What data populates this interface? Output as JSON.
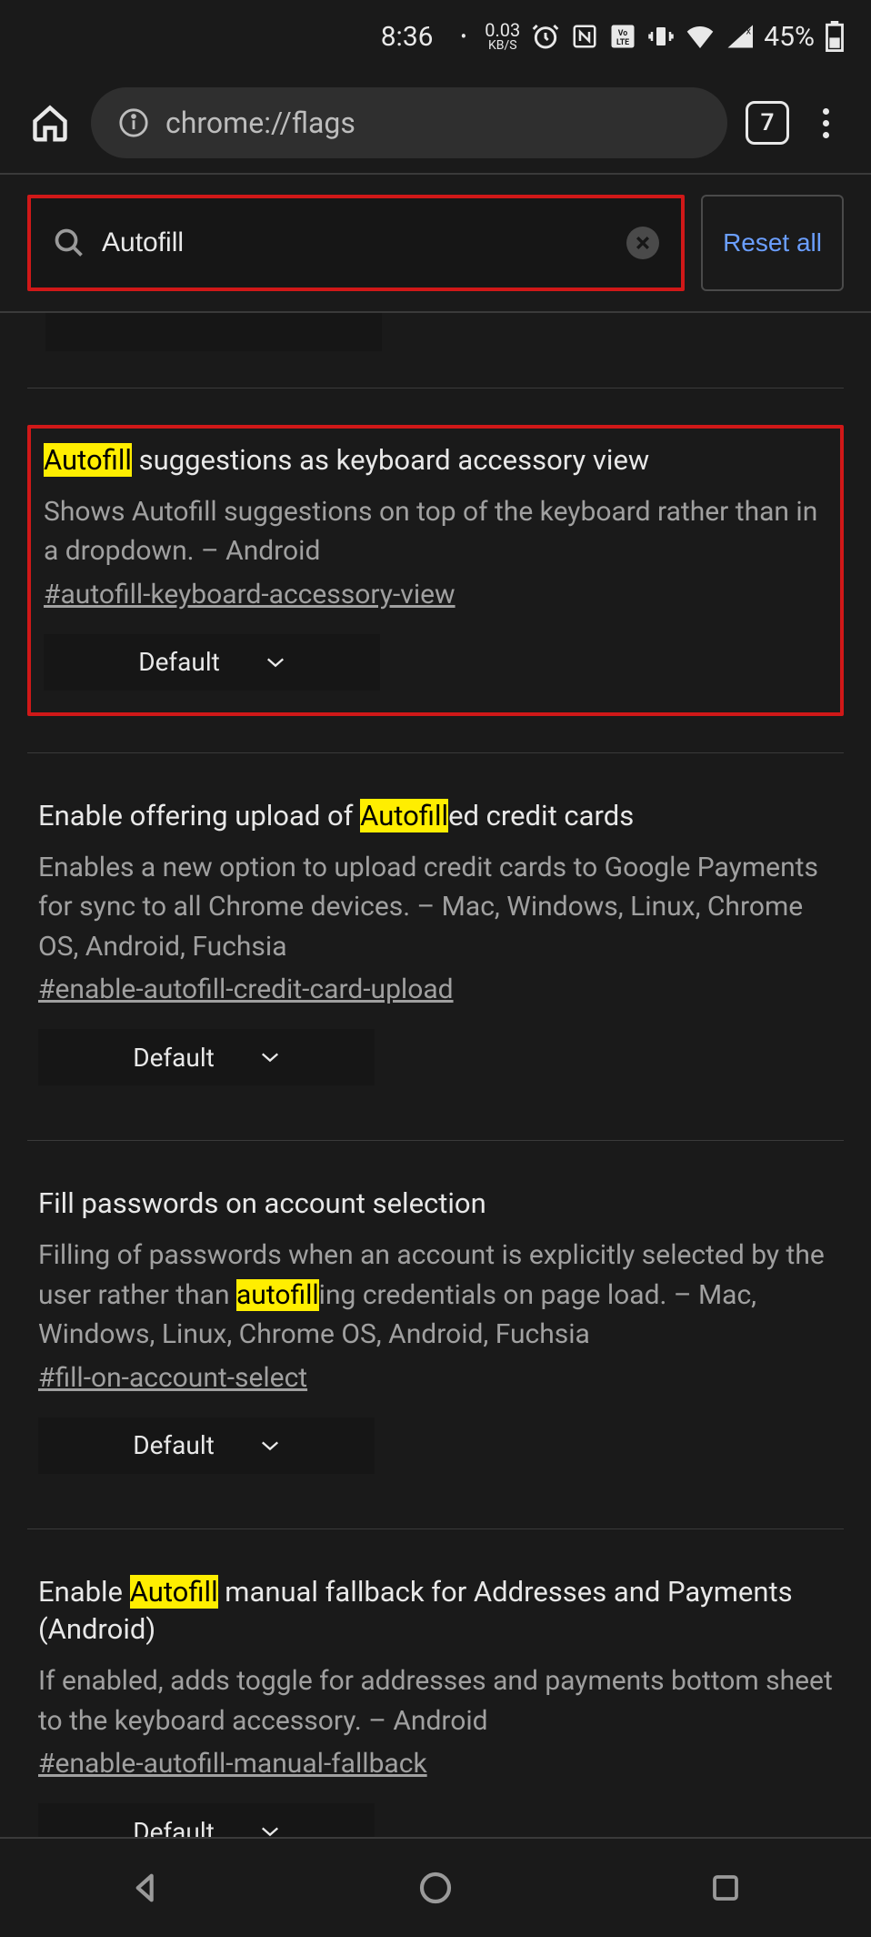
{
  "status": {
    "time": "8:36",
    "kbs_top": "0.03",
    "kbs_bot": "KB/S",
    "battery_pct": "45%"
  },
  "browser": {
    "url": "chrome://flags",
    "tab_count": "7"
  },
  "search": {
    "value": "Autofill",
    "reset_label": "Reset all"
  },
  "flags": [
    {
      "title_pre": "",
      "title_hl": "Autofill",
      "title_post": " suggestions as keyboard accessory view",
      "desc_pre": "Shows Autofill suggestions on top of the keyboard rather than in a dropdown. – Android",
      "desc_hl": "",
      "desc_post": "",
      "anchor": "#autofill-keyboard-accessory-view",
      "select": "Default",
      "highlighted": true
    },
    {
      "title_pre": "Enable offering upload of ",
      "title_hl": "Autofill",
      "title_post": "ed credit cards",
      "desc_pre": "Enables a new option to upload credit cards to Google Payments for sync to all Chrome devices. – Mac, Windows, Linux, Chrome OS, Android, Fuchsia",
      "desc_hl": "",
      "desc_post": "",
      "anchor": "#enable-autofill-credit-card-upload",
      "select": "Default",
      "highlighted": false
    },
    {
      "title_pre": "Fill passwords on account selection",
      "title_hl": "",
      "title_post": "",
      "desc_pre": "Filling of passwords when an account is explicitly selected by the user rather than ",
      "desc_hl": "autofill",
      "desc_post": "ing credentials on page load. – Mac, Windows, Linux, Chrome OS, Android, Fuchsia",
      "anchor": "#fill-on-account-select",
      "select": "Default",
      "highlighted": false
    },
    {
      "title_pre": "Enable ",
      "title_hl": "Autofill",
      "title_post": " manual fallback for Addresses and Payments (Android)",
      "desc_pre": "If enabled, adds toggle for addresses and payments bottom sheet to the keyboard accessory. – Android",
      "desc_hl": "",
      "desc_post": "",
      "anchor": "#enable-autofill-manual-fallback",
      "select": "Default",
      "highlighted": false
    }
  ]
}
